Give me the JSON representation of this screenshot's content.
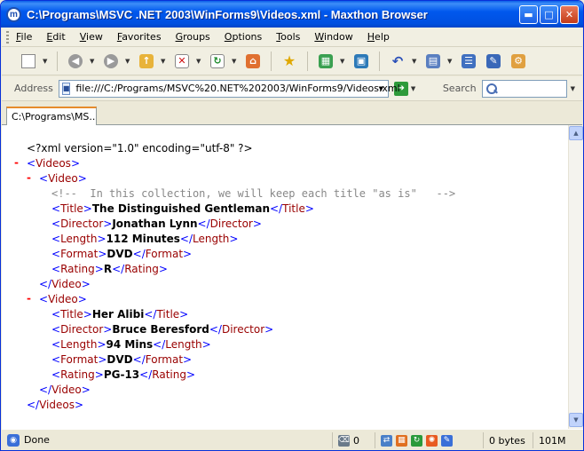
{
  "window": {
    "title": "C:\\Programs\\MSVC .NET 2003\\WinForms9\\Videos.xml - Maxthon Browser",
    "app_icon_glyph": "m"
  },
  "menu": [
    "File",
    "Edit",
    "View",
    "Favorites",
    "Groups",
    "Options",
    "Tools",
    "Window",
    "Help"
  ],
  "address": {
    "label": "Address",
    "value": "file:///C:/Programs/MSVC%20.NET%202003/WinForms9/Videos.xml"
  },
  "search": {
    "label": "Search",
    "value": ""
  },
  "tab": {
    "label": "C:\\Programs\\MS..."
  },
  "xml": {
    "declaration": "<?xml version=\"1.0\" encoding=\"utf-8\" ?>",
    "minus": "-",
    "root": "Videos",
    "video": "Video",
    "comment": "<!--  In this collection, we will keep each title \"as is\"   -->",
    "videos": [
      {
        "fields": [
          {
            "tag": "Title",
            "value": "The Distinguished Gentleman"
          },
          {
            "tag": "Director",
            "value": "Jonathan Lynn"
          },
          {
            "tag": "Length",
            "value": "112 Minutes"
          },
          {
            "tag": "Format",
            "value": "DVD"
          },
          {
            "tag": "Rating",
            "value": "R"
          }
        ]
      },
      {
        "fields": [
          {
            "tag": "Title",
            "value": "Her Alibi"
          },
          {
            "tag": "Director",
            "value": "Bruce Beresford"
          },
          {
            "tag": "Length",
            "value": "94 Mins"
          },
          {
            "tag": "Format",
            "value": "DVD"
          },
          {
            "tag": "Rating",
            "value": "PG-13"
          }
        ]
      }
    ]
  },
  "status": {
    "text": "Done",
    "trash_count": "0",
    "size": "0 bytes",
    "memory": "101M"
  },
  "icons": {
    "new_page": "new-page-icon",
    "back": "back-icon",
    "forward": "forward-icon",
    "up": "up-icon",
    "stop": "stop-icon",
    "refresh": "refresh-icon",
    "home": "home-icon",
    "favorites": "favorites-star-icon",
    "groups": "groups-icon",
    "window": "window-icon",
    "undo": "undo-icon",
    "view": "view-icon",
    "list": "list-icon",
    "edit": "edit-icon",
    "tools": "tools-icon"
  }
}
